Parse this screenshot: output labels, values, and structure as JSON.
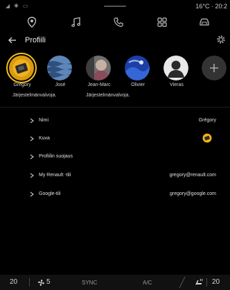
{
  "status": {
    "right_text": "16°C · 20:2"
  },
  "header": {
    "title": "Profiili"
  },
  "profiles": [
    {
      "name": "Grégory",
      "sub": "Järjestelmänvalvoja.",
      "avatar": "gregory-avatar"
    },
    {
      "name": "José",
      "sub": "",
      "avatar": "jose-avatar"
    },
    {
      "name": "Jean-Marc",
      "sub": "Järjestelmänvalvoja.",
      "avatar": "jean-marc-avatar"
    },
    {
      "name": "Olivier",
      "sub": "",
      "avatar": "olivier-avatar"
    },
    {
      "name": "Vieras",
      "sub": "",
      "avatar": "guest-avatar"
    }
  ],
  "settings": [
    {
      "label": "Nimi",
      "value": "Grégory"
    },
    {
      "label": "Kuva",
      "value": ""
    },
    {
      "label": "Profiilin suojaus",
      "value": ""
    },
    {
      "label": "My Renault -tili",
      "value": "gregory@renault.com"
    },
    {
      "label": "Google-tili",
      "value": "gregory@google.com"
    }
  ],
  "bottom": {
    "temp_left": "20",
    "fan_level": "5",
    "sync_label": "SYNC",
    "ac_label": "A/C",
    "temp_right": "20"
  },
  "colors": {
    "accent": "#f6c21a",
    "background": "#000000"
  }
}
